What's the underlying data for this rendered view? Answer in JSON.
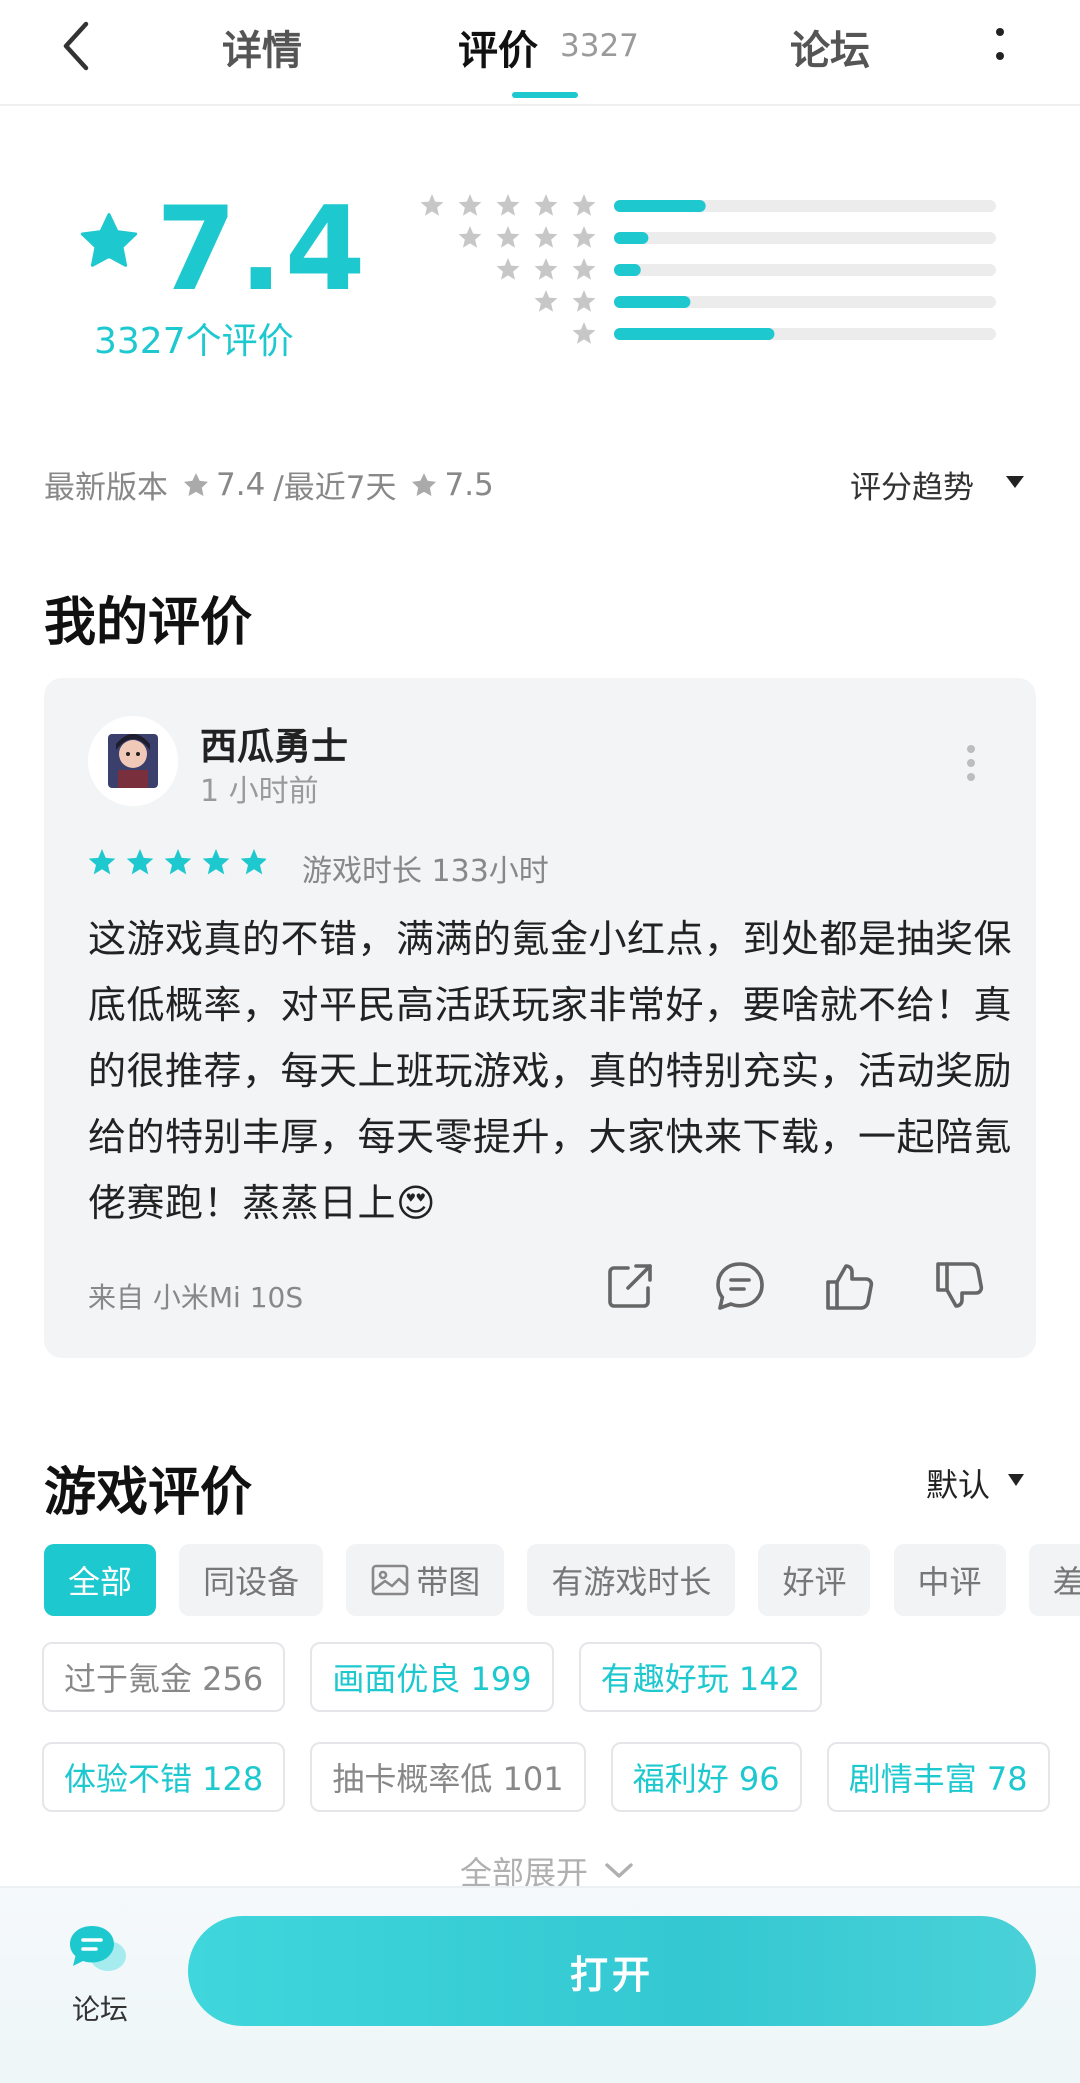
{
  "nav": {
    "tabs": [
      {
        "label": "详情"
      },
      {
        "label": "评价",
        "count": "3327"
      },
      {
        "label": "论坛"
      }
    ]
  },
  "rating": {
    "score": "7.4",
    "count_label": "3327个评价",
    "distribution": [
      {
        "stars": 5,
        "fraction": 0.24
      },
      {
        "stars": 4,
        "fraction": 0.09
      },
      {
        "stars": 3,
        "fraction": 0.07
      },
      {
        "stars": 2,
        "fraction": 0.2
      },
      {
        "stars": 1,
        "fraction": 0.42
      }
    ],
    "version_label": "最新版本",
    "version_score": "7.4",
    "recent_label": "/最近7天",
    "recent_score": "7.5",
    "trend_label": "评分趋势"
  },
  "my_review": {
    "heading": "我的评价",
    "username": "西瓜勇士",
    "time": "1 小时前",
    "stars": 5,
    "playtime": "游戏时长 133小时",
    "content": "这游戏真的不错，满满的氪金小红点，到处都是抽奖保底低概率，对平民高活跃玩家非常好，要啥就不给！真的很推荐，每天上班玩游戏，真的特别充实，活动奖励给的特别丰厚，每天零提升，大家快来下载，一起陪氪佬赛跑！蒸蒸日上😍",
    "source": "来自 小米Mi 10S"
  },
  "game_reviews": {
    "heading": "游戏评价",
    "sort_label": "默认",
    "filters": [
      "全部",
      "同设备",
      "带图",
      "有游戏时长",
      "好评",
      "中评",
      "差评"
    ],
    "tags_row1": [
      "过于氪金 256",
      "画面优良 199",
      "有趣好玩 142"
    ],
    "tags_row2": [
      "体验不错 128",
      "抽卡概率低 101",
      "福利好 96",
      "剧情丰富 78"
    ],
    "expand_label": "全部展开"
  },
  "bottom": {
    "forum_label": "论坛",
    "open_label": "打开"
  },
  "colors": {
    "accent": "#1ec8cf",
    "muted_star": "#c7c7c7",
    "bar_track": "#ececec"
  }
}
